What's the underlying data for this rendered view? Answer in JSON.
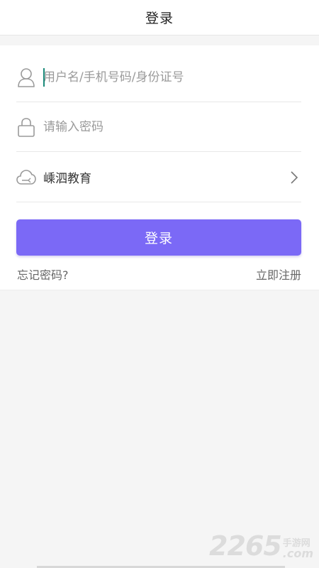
{
  "header": {
    "title": "登录"
  },
  "form": {
    "username": {
      "placeholder": "用户名/手机号码/身份证号",
      "value": ""
    },
    "password": {
      "placeholder": "请输入密码",
      "value": ""
    },
    "school": {
      "selected": "嵊泗教育"
    },
    "login_label": "登录",
    "forgot_label": "忘记密码?",
    "register_label": "立即注册"
  },
  "icons": {
    "user": "user-icon",
    "lock": "lock-icon",
    "school": "cloud-icon",
    "chevron": "chevron-right-icon"
  },
  "colors": {
    "accent": "#7b69f6",
    "caret": "#1b8a7a"
  },
  "watermark": {
    "number": "2265",
    "site_cn": "手游网",
    "site_com": ".com"
  }
}
